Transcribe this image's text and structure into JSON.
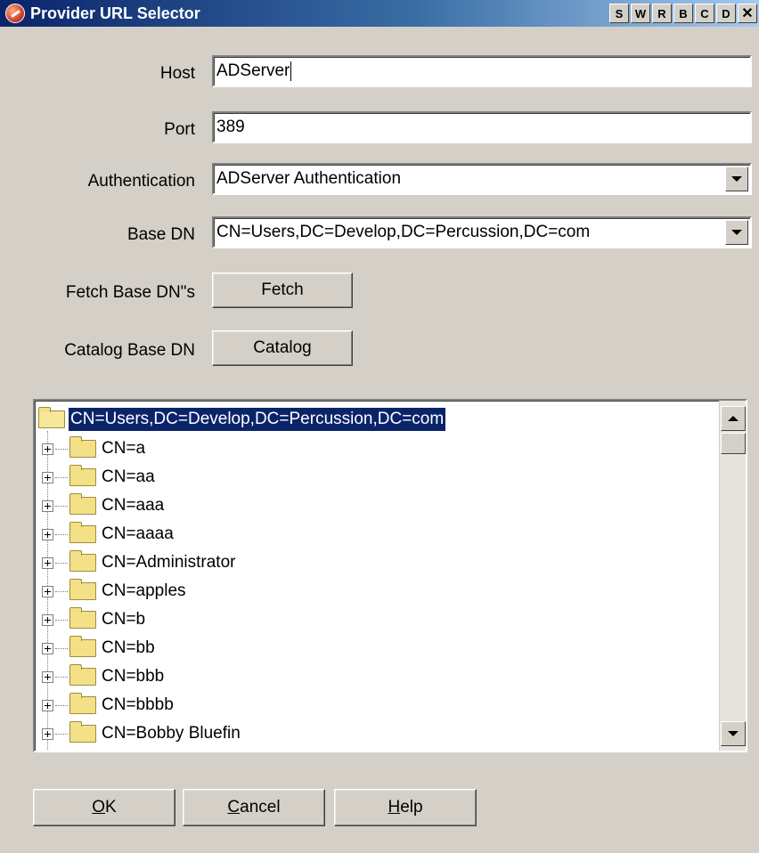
{
  "window": {
    "title": "Provider URL Selector",
    "title_buttons": [
      "S",
      "W",
      "R",
      "B",
      "C",
      "D",
      "✕"
    ]
  },
  "form": {
    "host": {
      "label": "Host",
      "value": "ADServer"
    },
    "port": {
      "label": "Port",
      "value": "389"
    },
    "authentication": {
      "label": "Authentication",
      "value": "ADServer Authentication"
    },
    "base_dn": {
      "label": "Base DN",
      "value": "CN=Users,DC=Develop,DC=Percussion,DC=com"
    },
    "fetch": {
      "label": "Fetch Base DN\"s",
      "button": "Fetch"
    },
    "catalog": {
      "label": "Catalog Base DN",
      "button": "Catalog"
    }
  },
  "tree": {
    "root": "CN=Users,DC=Develop,DC=Percussion,DC=com",
    "nodes": [
      "CN=a",
      "CN=aa",
      "CN=aaa",
      "CN=aaaa",
      "CN=Administrator",
      "CN=apples",
      "CN=b",
      "CN=bb",
      "CN=bbb",
      "CN=bbbb",
      "CN=Bobby Bluefin"
    ]
  },
  "footer": {
    "ok": {
      "mnemonic": "O",
      "rest": "K"
    },
    "cancel": {
      "mnemonic": "C",
      "rest": "ancel"
    },
    "help": {
      "mnemonic": "H",
      "rest": "elp"
    }
  },
  "icons": {
    "app": "app-logo-icon",
    "dropdown": "chevron-down-icon",
    "folder": "folder-icon",
    "expander": "plus-box-icon"
  }
}
